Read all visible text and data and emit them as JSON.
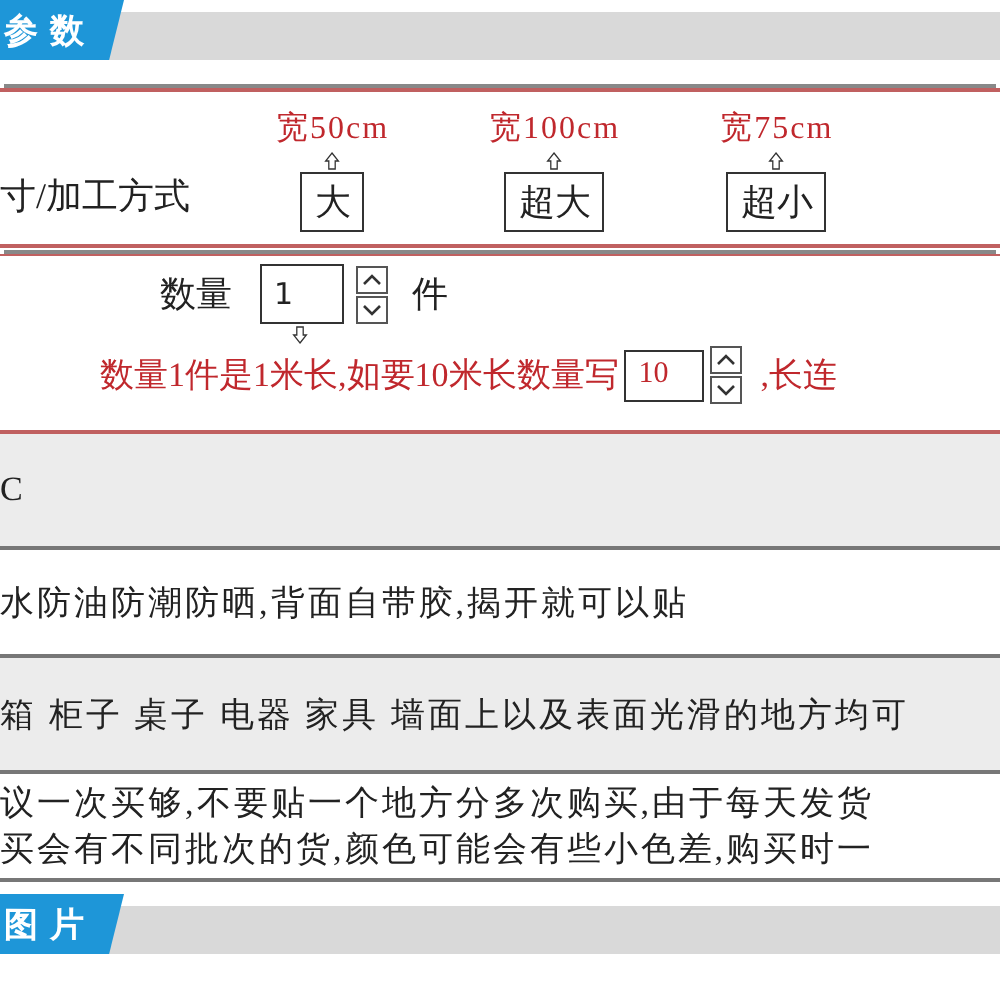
{
  "section_header": {
    "title": "参数"
  },
  "size_selector": {
    "label": "寸/加工方式",
    "options": [
      {
        "width": "宽50cm",
        "label": "大"
      },
      {
        "width": "宽100cm",
        "label": "超大"
      },
      {
        "width": "宽75cm",
        "label": "超小"
      }
    ]
  },
  "quantity": {
    "label": "数量",
    "value": "1",
    "unit": "件",
    "note_before": "数量1件是1米长,如要10米长数量写",
    "note_value": "10",
    "note_after": ",长连"
  },
  "spec_rows": [
    {
      "text": "C",
      "shaded": true
    },
    {
      "text": "水防油防潮防晒,背面自带胶,揭开就可以贴",
      "shaded": false
    },
    {
      "text": "箱 柜子 桌子 电器 家具 墙面上以及表面光滑的地方均可",
      "shaded": true
    },
    {
      "lines": [
        "议一次买够,不要贴一个地方分多次购买,由于每天发货",
        "买会有不同批次的货,颜色可能会有些小色差,购买时一"
      ],
      "shaded": false
    }
  ],
  "footer_header": {
    "title": "图片"
  }
}
